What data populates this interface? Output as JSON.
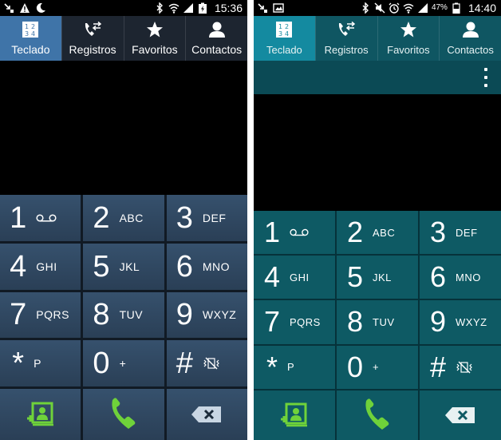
{
  "left": {
    "status_time": "15:36",
    "tabs": [
      {
        "label": "Teclado",
        "icon": "dialpad-icon",
        "active": true
      },
      {
        "label": "Registros",
        "icon": "call-log-icon",
        "active": false
      },
      {
        "label": "Favoritos",
        "icon": "star-icon",
        "active": false
      },
      {
        "label": "Contactos",
        "icon": "contact-icon",
        "active": false
      }
    ],
    "keys": [
      {
        "digit": "1",
        "letters": "",
        "icon": "voicemail-icon"
      },
      {
        "digit": "2",
        "letters": "ABC"
      },
      {
        "digit": "3",
        "letters": "DEF"
      },
      {
        "digit": "4",
        "letters": "GHI"
      },
      {
        "digit": "5",
        "letters": "JKL"
      },
      {
        "digit": "6",
        "letters": "MNO"
      },
      {
        "digit": "7",
        "letters": "PQRS"
      },
      {
        "digit": "8",
        "letters": "TUV"
      },
      {
        "digit": "9",
        "letters": "WXYZ"
      },
      {
        "digit": "*",
        "letters": "P"
      },
      {
        "digit": "0",
        "letters": "+"
      },
      {
        "digit": "#",
        "letters": "",
        "icon": "vibrate-off-icon"
      }
    ]
  },
  "right": {
    "status_time": "14:40",
    "battery_percent": "47%",
    "tabs": [
      {
        "label": "Teclado",
        "icon": "dialpad-icon",
        "active": true
      },
      {
        "label": "Registros",
        "icon": "call-log-icon",
        "active": false
      },
      {
        "label": "Favoritos",
        "icon": "star-icon",
        "active": false
      },
      {
        "label": "Contactos",
        "icon": "contact-icon",
        "active": false
      }
    ],
    "keys": [
      {
        "digit": "1",
        "letters": "",
        "icon": "voicemail-icon"
      },
      {
        "digit": "2",
        "letters": "ABC"
      },
      {
        "digit": "3",
        "letters": "DEF"
      },
      {
        "digit": "4",
        "letters": "GHI"
      },
      {
        "digit": "5",
        "letters": "JKL"
      },
      {
        "digit": "6",
        "letters": "MNO"
      },
      {
        "digit": "7",
        "letters": "PQRS"
      },
      {
        "digit": "8",
        "letters": "TUV"
      },
      {
        "digit": "9",
        "letters": "WXYZ"
      },
      {
        "digit": "*",
        "letters": "P"
      },
      {
        "digit": "0",
        "letters": "+"
      },
      {
        "digit": "#",
        "letters": "",
        "icon": "vibrate-off-icon"
      }
    ]
  },
  "colors": {
    "call_green": "#6fd23a",
    "left_key": "#314a64",
    "right_key": "#0e5a64",
    "left_tab_active": "#3f74a8",
    "right_tab_active": "#148aa0"
  }
}
